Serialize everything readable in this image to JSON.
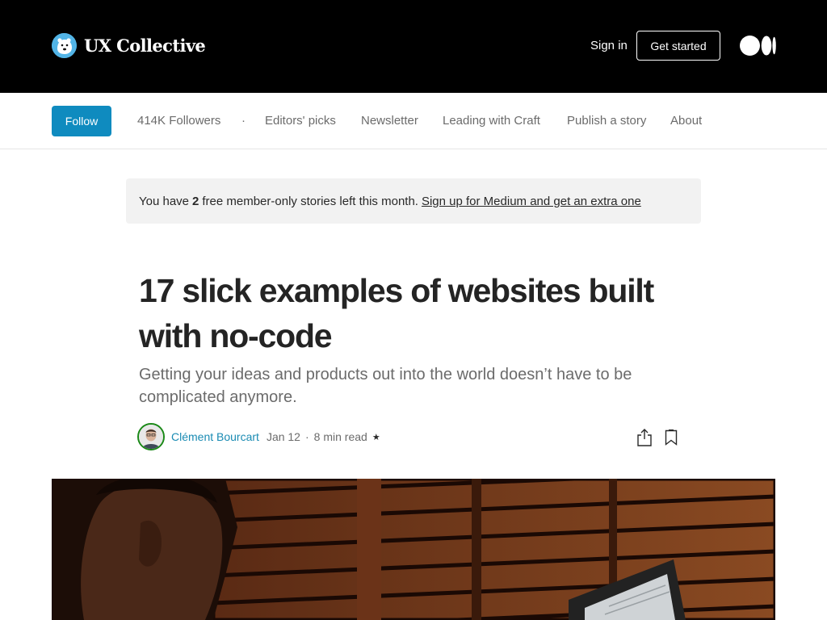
{
  "header": {
    "brand_name": "UX Collective",
    "signin_label": "Sign in",
    "get_started_label": "Get started"
  },
  "publication_nav": {
    "follow_label": "Follow",
    "followers": "414K Followers",
    "dot": "·",
    "links": [
      "Editors' picks",
      "Newsletter",
      "Leading with Craft",
      "Publish a story",
      "About"
    ]
  },
  "banner": {
    "prefix": "You have",
    "count": "2",
    "suffix": "free member-only stories left this month.",
    "link": "Sign up for Medium and get an extra one"
  },
  "article": {
    "title": "17 slick examples of websites built with no-code",
    "subtitle": "Getting your ideas and products out into the world doesn’t have to be complicated anymore.",
    "author": "Clément Bourcart",
    "date": "Jan 12",
    "separator": "·",
    "read_time": "8 min read",
    "member_star": "★"
  },
  "colors": {
    "header_bg": "#000000",
    "follow_button": "#0f8bbf",
    "author_link": "#1a8bb3",
    "avatar_ring": "#1a8917",
    "banner_bg": "#f2f2f2"
  },
  "icons": {
    "brand": "polar-bear-logo",
    "medium": "medium-logo",
    "share": "share-icon",
    "bookmark": "bookmark-icon"
  }
}
